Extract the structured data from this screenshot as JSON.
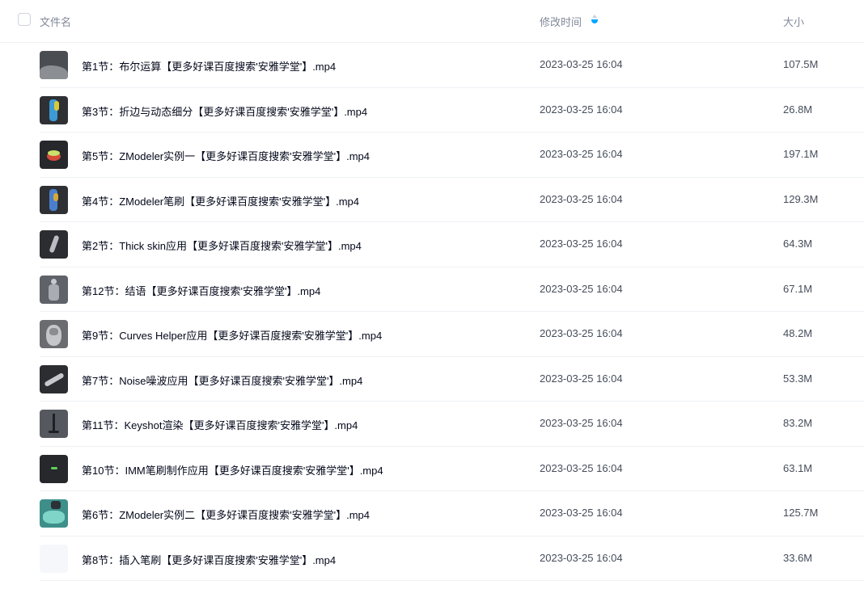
{
  "header": {
    "name_label": "文件名",
    "time_label": "修改时间",
    "size_label": "大小",
    "sort_icon": "sort-descending-icon",
    "accent": "#06a7ff"
  },
  "files": [
    {
      "name": "第1节：布尔运算【更多好课百度搜索'安雅学堂'】.mp4",
      "time": "2023-03-25 16:04",
      "size": "107.5M"
    },
    {
      "name": "第3节：折边与动态细分【更多好课百度搜索'安雅学堂'】.mp4",
      "time": "2023-03-25 16:04",
      "size": "26.8M"
    },
    {
      "name": "第5节：ZModeler实例一【更多好课百度搜索'安雅学堂'】.mp4",
      "time": "2023-03-25 16:04",
      "size": "197.1M"
    },
    {
      "name": "第4节：ZModeler笔刷【更多好课百度搜索'安雅学堂'】.mp4",
      "time": "2023-03-25 16:04",
      "size": "129.3M"
    },
    {
      "name": "第2节：Thick skin应用【更多好课百度搜索'安雅学堂'】.mp4",
      "time": "2023-03-25 16:04",
      "size": "64.3M"
    },
    {
      "name": "第12节：结语【更多好课百度搜索'安雅学堂'】.mp4",
      "time": "2023-03-25 16:04",
      "size": "67.1M"
    },
    {
      "name": "第9节：Curves Helper应用【更多好课百度搜索'安雅学堂'】.mp4",
      "time": "2023-03-25 16:04",
      "size": "48.2M"
    },
    {
      "name": "第7节：Noise噪波应用【更多好课百度搜索'安雅学堂'】.mp4",
      "time": "2023-03-25 16:04",
      "size": "53.3M"
    },
    {
      "name": "第11节：Keyshot渲染【更多好课百度搜索'安雅学堂'】.mp4",
      "time": "2023-03-25 16:04",
      "size": "83.2M"
    },
    {
      "name": "第10节：IMM笔刷制作应用【更多好课百度搜索'安雅学堂'】.mp4",
      "time": "2023-03-25 16:04",
      "size": "63.1M"
    },
    {
      "name": "第6节：ZModeler实例二【更多好课百度搜索'安雅学堂'】.mp4",
      "time": "2023-03-25 16:04",
      "size": "125.7M"
    },
    {
      "name": "第8节：插入笔刷【更多好课百度搜索'安雅学堂'】.mp4",
      "time": "2023-03-25 16:04",
      "size": "33.6M"
    }
  ]
}
